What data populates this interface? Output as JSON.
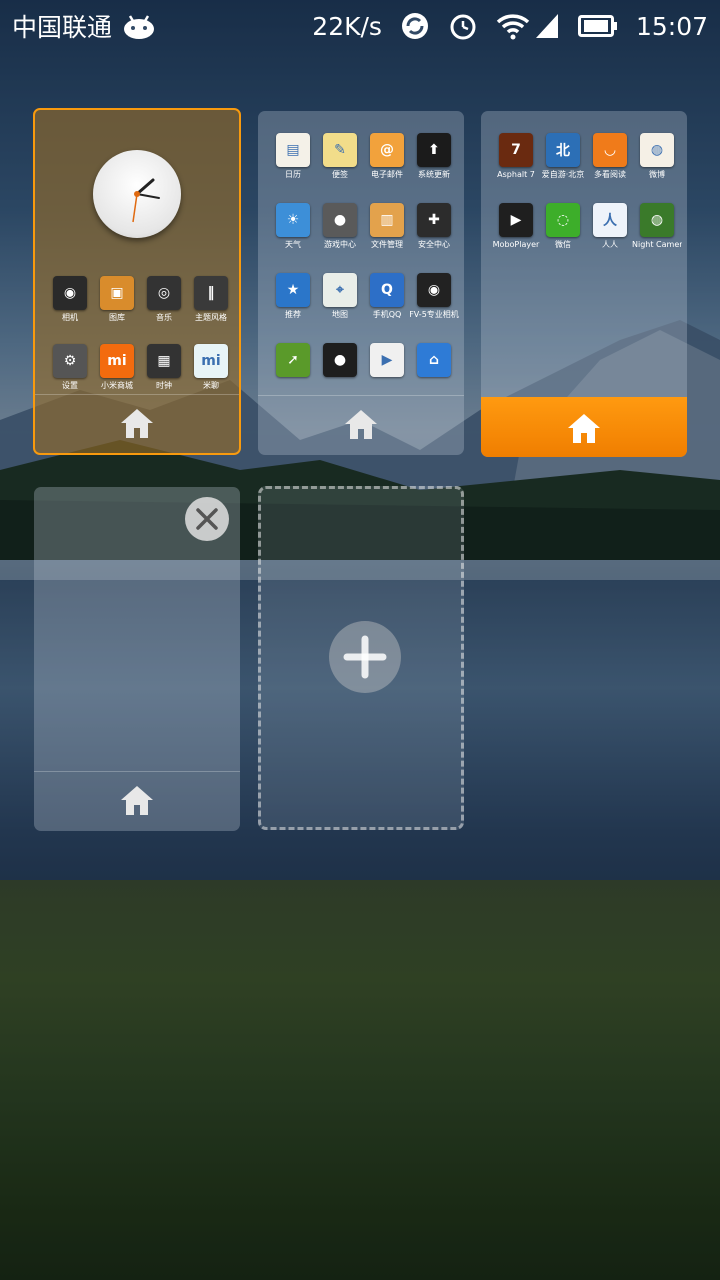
{
  "status_bar": {
    "carrier": "中国联通",
    "net_speed": "22K/s",
    "time": "15:07",
    "icons": [
      "android-icon",
      "sync-icon",
      "alarm-icon",
      "wifi-icon",
      "signal-icon",
      "battery-icon"
    ]
  },
  "screens": [
    {
      "state": "current",
      "apps": [
        {
          "label": "相机",
          "icon": "camera-icon",
          "color": "#2a2a2a"
        },
        {
          "label": "图库",
          "icon": "gallery-icon",
          "color": "#d98c2c"
        },
        {
          "label": "音乐",
          "icon": "music-icon",
          "color": "#333333"
        },
        {
          "label": "主题风格",
          "icon": "themes-icon",
          "color": "#3a3a3a"
        },
        {
          "label": "设置",
          "icon": "settings-icon",
          "color": "#555555"
        },
        {
          "label": "小米商城",
          "icon": "mi-store-icon",
          "color": "#f36b0e"
        },
        {
          "label": "时钟",
          "icon": "tools-icon",
          "color": "#333333"
        },
        {
          "label": "米聊",
          "icon": "miliao-icon",
          "color": "#e8f4f7"
        }
      ]
    },
    {
      "state": "normal",
      "apps": [
        {
          "label": "日历",
          "icon": "calendar-icon",
          "color": "#f4f1e8"
        },
        {
          "label": "便签",
          "icon": "notes-icon",
          "color": "#f2dd8a"
        },
        {
          "label": "电子邮件",
          "icon": "email-icon",
          "color": "#f2a23c"
        },
        {
          "label": "系统更新",
          "icon": "update-icon",
          "color": "#1b1b1b"
        },
        {
          "label": "天气",
          "icon": "weather-icon",
          "color": "#3d8fd8"
        },
        {
          "label": "游戏中心",
          "icon": "game-center-icon",
          "color": "#5a5a5a"
        },
        {
          "label": "文件管理",
          "icon": "file-manager-icon",
          "color": "#e3a24c"
        },
        {
          "label": "安全中心",
          "icon": "security-icon",
          "color": "#2c2c2c"
        },
        {
          "label": "推荐",
          "icon": "recommend-icon",
          "color": "#2b76c9"
        },
        {
          "label": "地图",
          "icon": "maps-icon",
          "color": "#e9eee9"
        },
        {
          "label": "手机QQ",
          "icon": "qq-icon",
          "color": "#2d6fc7"
        },
        {
          "label": "FV-5专业相机",
          "icon": "fv5-camera-icon",
          "color": "#222222"
        },
        {
          "label": "",
          "icon": "app-green-icon",
          "color": "#5a9a2a"
        },
        {
          "label": "",
          "icon": "panda-icon",
          "color": "#1e1e1e"
        },
        {
          "label": "",
          "icon": "play-store-icon",
          "color": "#f0f0f0"
        },
        {
          "label": "",
          "icon": "app-home-icon",
          "color": "#2e7bd6"
        }
      ]
    },
    {
      "state": "default-home",
      "apps": [
        {
          "label": "Asphalt 7",
          "icon": "asphalt-icon",
          "color": "#6a2a10"
        },
        {
          "label": "爱自游·北京",
          "icon": "travel-beijing-icon",
          "color": "#2c6fb6"
        },
        {
          "label": "多看阅读",
          "icon": "duokan-icon",
          "color": "#f07b1a"
        },
        {
          "label": "微博",
          "icon": "weibo-icon",
          "color": "#f5f0e6"
        },
        {
          "label": "MoboPlayer",
          "icon": "moboplayer-icon",
          "color": "#1f1f1f"
        },
        {
          "label": "微信",
          "icon": "wechat-icon",
          "color": "#3dae2a"
        },
        {
          "label": "人人",
          "icon": "renren-icon",
          "color": "#eef3fa"
        },
        {
          "label": "Night Camera",
          "icon": "night-camera-icon",
          "color": "#3a7a2a"
        }
      ]
    },
    {
      "state": "empty",
      "apps": []
    }
  ],
  "controls": {
    "close_icon": "close-icon",
    "add_icon": "plus-icon",
    "home_icon": "home-icon"
  },
  "colors": {
    "accent": "#f89a0e",
    "default_home_bar": "#f58600"
  }
}
